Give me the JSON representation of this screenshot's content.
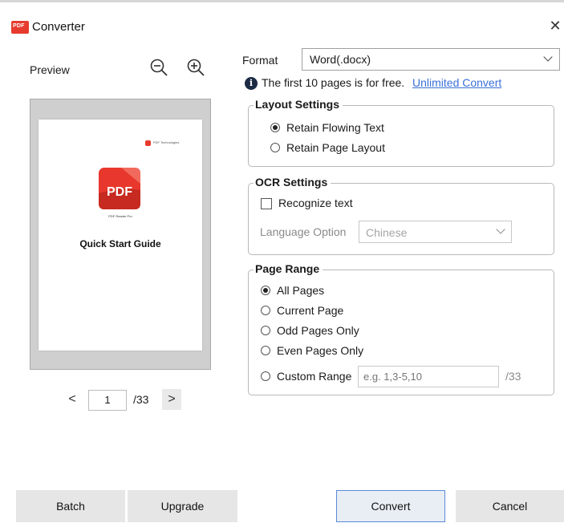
{
  "window": {
    "title": "Converter",
    "app_icon": "pdf-app-icon",
    "app_icon_text": "PDF",
    "close_glyph": "✕"
  },
  "preview": {
    "label": "Preview",
    "zoom_out_icon": "zoom-out-icon",
    "zoom_in_icon": "zoom-in-icon",
    "page": {
      "brand": "PDF Technologies",
      "logo_text": "PDF",
      "product": "PDF Reader Pro",
      "heading": "Quick Start Guide"
    },
    "pager": {
      "prev": "<",
      "current": "1",
      "total": "/33",
      "next": ">"
    }
  },
  "format": {
    "label": "Format",
    "value": "Word(.docx)"
  },
  "notice": {
    "text": "The first 10 pages is for free.",
    "link": "Unlimited Convert",
    "icon": "info-icon"
  },
  "layout_settings": {
    "title": "Layout Settings",
    "options": [
      {
        "label": "Retain Flowing Text",
        "selected": true
      },
      {
        "label": "Retain Page Layout",
        "selected": false
      }
    ]
  },
  "ocr_settings": {
    "title": "OCR Settings",
    "recognize_label": "Recognize text",
    "recognize_checked": false,
    "language_label": "Language Option",
    "language_value": "Chinese"
  },
  "page_range": {
    "title": "Page Range",
    "options": [
      {
        "label": "All Pages",
        "selected": true
      },
      {
        "label": "Current Page",
        "selected": false
      },
      {
        "label": "Odd Pages Only",
        "selected": false
      },
      {
        "label": "Even Pages Only",
        "selected": false
      },
      {
        "label": "Custom Range",
        "selected": false
      }
    ],
    "custom_placeholder": "e.g. 1,3-5,10",
    "custom_total": "/33"
  },
  "buttons": {
    "batch": "Batch",
    "upgrade": "Upgrade",
    "convert": "Convert",
    "cancel": "Cancel"
  },
  "colors": {
    "accent": "#5b8ad8",
    "link": "#3a6fd8",
    "brand_red": "#e63b2e"
  }
}
